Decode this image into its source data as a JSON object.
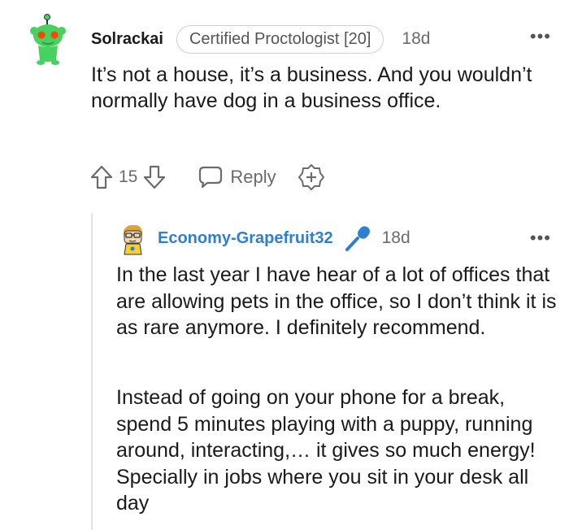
{
  "comment": {
    "username": "Solrackai",
    "flair": "Certified Proctologist [20]",
    "time": "18d",
    "more_label": "•••",
    "body": "It’s not a house, it’s a business. And you wouldn’t normally have dog in a business office.",
    "vote_count": "15",
    "reply_label": "Reply"
  },
  "reply": {
    "username": "Economy-Grapefruit32",
    "time": "18d",
    "more_label": "•••",
    "paragraphs": [
      "In the last year I have hear of a lot of offices that are allowing pets in the office, so I don’t think it is as rare anymore. I definitely recommend.",
      "Instead of going on your phone for a break, spend 5 minutes playing with a puppy, running around, interacting,… it gives so much energy! Specially in jobs where you sit in your desk all day"
    ]
  },
  "colors": {
    "username_blue": "#2e7fd4",
    "avatar_green": "#46d160",
    "eye_red": "#ff4500",
    "meta_gray": "#6b6b6b"
  },
  "icons": [
    "snoo-avatar-icon",
    "upvote-icon",
    "downvote-icon",
    "comment-bubble-icon",
    "add-award-icon",
    "avatar-icon",
    "microphone-icon",
    "more-options-icon"
  ]
}
